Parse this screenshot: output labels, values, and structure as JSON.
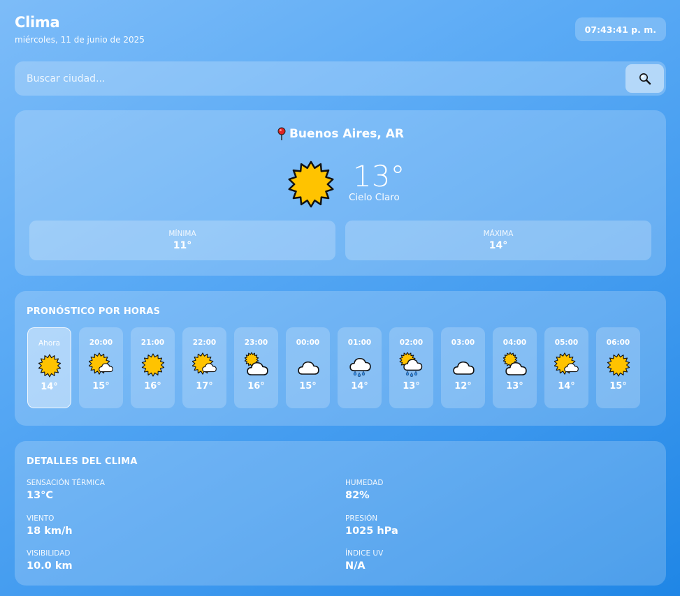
{
  "header": {
    "title": "Clima",
    "date": "miércoles, 11 de junio de 2025",
    "clock": "07:43:41 p. m."
  },
  "search": {
    "placeholder": "Buscar ciudad..."
  },
  "current": {
    "location": "Buenos Aires, AR",
    "temperature": "13°",
    "condition": "Cielo Claro",
    "icon": "sun-icon",
    "min_label": "MÍNIMA",
    "min_value": "11°",
    "max_label": "MÁXIMA",
    "max_value": "14°"
  },
  "hourly": {
    "title": "PRONÓSTICO POR HORAS",
    "items": [
      {
        "time": "Ahora",
        "temp": "14°",
        "icon": "sun"
      },
      {
        "time": "20:00",
        "temp": "15°",
        "icon": "sun-cloud"
      },
      {
        "time": "21:00",
        "temp": "16°",
        "icon": "sun"
      },
      {
        "time": "22:00",
        "temp": "17°",
        "icon": "sun-cloud"
      },
      {
        "time": "23:00",
        "temp": "16°",
        "icon": "cloud-sun"
      },
      {
        "time": "00:00",
        "temp": "15°",
        "icon": "cloud"
      },
      {
        "time": "01:00",
        "temp": "14°",
        "icon": "rain"
      },
      {
        "time": "02:00",
        "temp": "13°",
        "icon": "sun-rain"
      },
      {
        "time": "03:00",
        "temp": "12°",
        "icon": "cloud"
      },
      {
        "time": "04:00",
        "temp": "13°",
        "icon": "cloud-sun"
      },
      {
        "time": "05:00",
        "temp": "14°",
        "icon": "sun-cloud"
      },
      {
        "time": "06:00",
        "temp": "15°",
        "icon": "sun"
      }
    ]
  },
  "details": {
    "title": "DETALLES DEL CLIMA",
    "feels_like_label": "SENSACIÓN TÉRMICA",
    "feels_like_value": "13°C",
    "humidity_label": "HUMEDAD",
    "humidity_value": "82%",
    "wind_label": "VIENTO",
    "wind_value": "18 km/h",
    "pressure_label": "PRESIÓN",
    "pressure_value": "1025 hPa",
    "visibility_label": "VISIBILIDAD",
    "visibility_value": "10.0 km",
    "uv_label": "ÍNDICE UV",
    "uv_value": "N/A"
  },
  "colors": {
    "sun_fill": "#ffc300",
    "sun_outline": "#111111",
    "cloud_fill": "#ffffff",
    "rain_drop": "#3a8fe0"
  }
}
